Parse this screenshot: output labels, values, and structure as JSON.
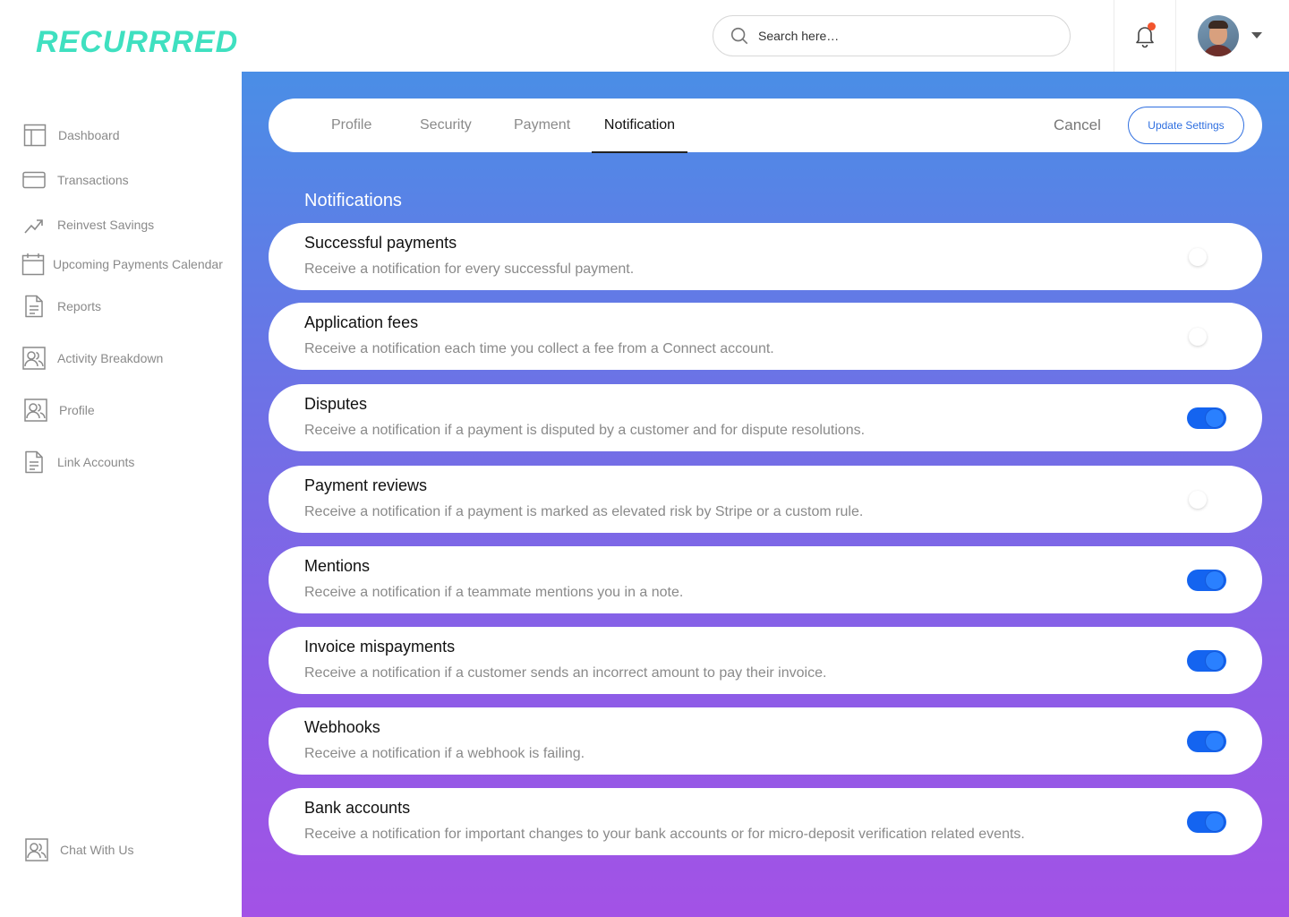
{
  "app": {
    "logo": "RECURRRED"
  },
  "header": {
    "search_placeholder": "Search here…",
    "notification_badge_color": "#f2542d"
  },
  "sidebar": {
    "items": [
      {
        "label": "Dashboard",
        "icon": "dashboard-icon"
      },
      {
        "label": "Transactions",
        "icon": "credit-card-icon"
      },
      {
        "label": "Reinvest Savings",
        "icon": "trending-up-icon"
      },
      {
        "label": "Upcoming Payments Calendar",
        "icon": "calendar-icon"
      },
      {
        "label": "Reports",
        "icon": "document-icon"
      },
      {
        "label": "Activity Breakdown",
        "icon": "users-icon"
      },
      {
        "label": "Profile",
        "icon": "users-icon"
      },
      {
        "label": "Link Accounts",
        "icon": "document-icon"
      }
    ],
    "chat": {
      "label": "Chat With Us",
      "icon": "users-icon"
    }
  },
  "tabs": {
    "items": [
      "Profile",
      "Security",
      "Payment",
      "Notification"
    ],
    "active": "Notification",
    "cancel_label": "Cancel",
    "update_label": "Update Settings"
  },
  "notifications": {
    "section_title": "Notifications",
    "items": [
      {
        "title": "Successful payments",
        "description": "Receive a notification for every successful payment.",
        "enabled": false
      },
      {
        "title": "Application fees",
        "description": "Receive a notification each time you collect a fee from a Connect account.",
        "enabled": false
      },
      {
        "title": "Disputes",
        "description": "Receive a notification if a payment is disputed by a customer and for dispute resolutions.",
        "enabled": true
      },
      {
        "title": "Payment reviews",
        "description": "Receive a notification if a payment is marked as elevated risk by Stripe or a custom rule.",
        "enabled": false
      },
      {
        "title": "Mentions",
        "description": "Receive a notification if a teammate mentions you in a note.",
        "enabled": true
      },
      {
        "title": "Invoice mispayments",
        "description": "Receive a notification if a customer sends an incorrect amount to pay their invoice.",
        "enabled": true
      },
      {
        "title": "Webhooks",
        "description": "Receive a notification if a webhook is failing.",
        "enabled": true
      },
      {
        "title": "Bank accounts",
        "description": "Receive a notification for important changes to your bank accounts or for micro-deposit verification related events.",
        "enabled": true
      }
    ]
  },
  "colors": {
    "logo": "#3fe0c0",
    "accent": "#2f6fe0",
    "toggle_on": "#1464f0",
    "gradient_top": "#4a8ee6",
    "gradient_bottom": "#a352e6"
  }
}
